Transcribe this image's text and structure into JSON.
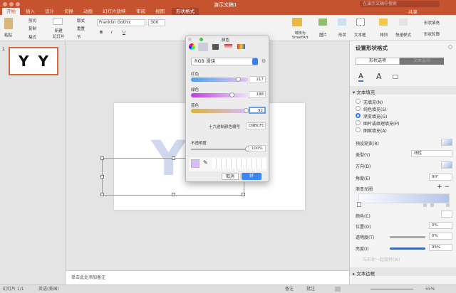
{
  "window": {
    "title": "演示文稿1",
    "search_placeholder": "在演示文稿中搜索",
    "share": "共享"
  },
  "tabs": [
    "开始",
    "插入",
    "设计",
    "切换",
    "动画",
    "幻灯片放映",
    "审阅",
    "视图",
    "形状格式"
  ],
  "ribbon": {
    "paste": "粘贴",
    "cut": "剪切",
    "copy": "复制",
    "format": "格式",
    "new_slide": "新建\n幻灯片",
    "layout": "版式",
    "reset": "重置",
    "section": "节",
    "font": "Franklin Gothic",
    "size": "300",
    "convert_smartart": "转换为\nSmartArt",
    "picture": "图片",
    "shape": "形状",
    "textbox": "文本框",
    "arrange": "排列",
    "quick_styles": "快速样式",
    "shape_fill": "形状填充",
    "shape_outline": "形状轮廓"
  },
  "thumbnail": {
    "number": "1",
    "text": "Y Y"
  },
  "slide": {
    "text": "Y"
  },
  "notes_placeholder": "单击此处添加备注",
  "status": {
    "slide": "幻灯片 1/1",
    "language": "英语(美国)",
    "notes": "备注",
    "comments": "批注",
    "zoom": "55%"
  },
  "color_dialog": {
    "title": "颜色",
    "mode": "RGB 滑块",
    "red_label": "红色",
    "red": "217",
    "green_label": "绿色",
    "green": "188",
    "blue_label": "蓝色",
    "blue": "92",
    "hex_label": "十六进制颜色编号",
    "hex": "D9BCFC",
    "opacity_label": "不透明度",
    "opacity": "100%",
    "cancel": "取消",
    "ok": "好",
    "colors": {
      "swatch": "#d9bcfc"
    }
  },
  "panel": {
    "title": "设置形状格式",
    "tab_shape": "形状选项",
    "tab_text": "文本选项",
    "section_fill": "文本填充",
    "fill_options": [
      "无填充(N)",
      "纯色填充(S)",
      "渐变填充(G)",
      "图片或纹理填充(P)",
      "图案填充(A)"
    ],
    "selected_fill": 2,
    "preset": "预设渐变(R)",
    "type_label": "类型(Y)",
    "type": "线性",
    "direction": "方向(D)",
    "angle_label": "角度(E)",
    "angle": "90°",
    "stops": "渐变光圈",
    "color": "颜色(C)",
    "position_label": "位置(O)",
    "position": "0%",
    "transparency_label": "透明度(T)",
    "transparency": "0%",
    "brightness_label": "亮度(I)",
    "brightness": "95%",
    "rotate": "与形状一起旋转(W)",
    "section_border": "文本边框"
  },
  "colors": {
    "accent": "#c6532f"
  }
}
